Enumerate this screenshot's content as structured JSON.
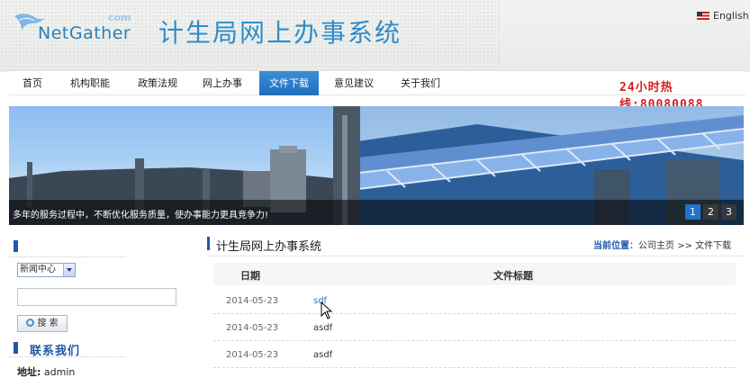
{
  "header": {
    "logo_text": "NetGather",
    "logo_com": "com",
    "title": "计生局网上办事系统",
    "lang": "English"
  },
  "nav": {
    "items": [
      "首页",
      "机构职能",
      "政策法规",
      "网上办事",
      "文件下载",
      "意见建议",
      "关于我们"
    ],
    "active_index": 4,
    "hotline": "24小时热线:80080088"
  },
  "banner": {
    "caption": "多年的服务过程中，不断优化服务质量，使办事能力更具竞争力!",
    "pages": [
      "1",
      "2",
      "3"
    ],
    "active_page": "1"
  },
  "sidebar": {
    "category_select": "新闻中心",
    "search_button": "搜 索",
    "contact_title": "联系我们",
    "address_label": "地址:",
    "address_value": "admin"
  },
  "content": {
    "title": "计生局网上办事系统",
    "crumb_label": "当前位置",
    "crumb_home": "：公司主页",
    "crumb_sep": ">>",
    "crumb_current": "文件下载",
    "columns": [
      "日期",
      "文件标题"
    ],
    "rows": [
      {
        "date": "2014-05-23",
        "title": "sdf"
      },
      {
        "date": "2014-05-23",
        "title": "asdf"
      },
      {
        "date": "2014-05-23",
        "title": "asdf"
      }
    ]
  },
  "colors": {
    "accent": "#2d8cc9",
    "nav_active": "#1e6fbf",
    "hotline": "#d81d1d"
  }
}
